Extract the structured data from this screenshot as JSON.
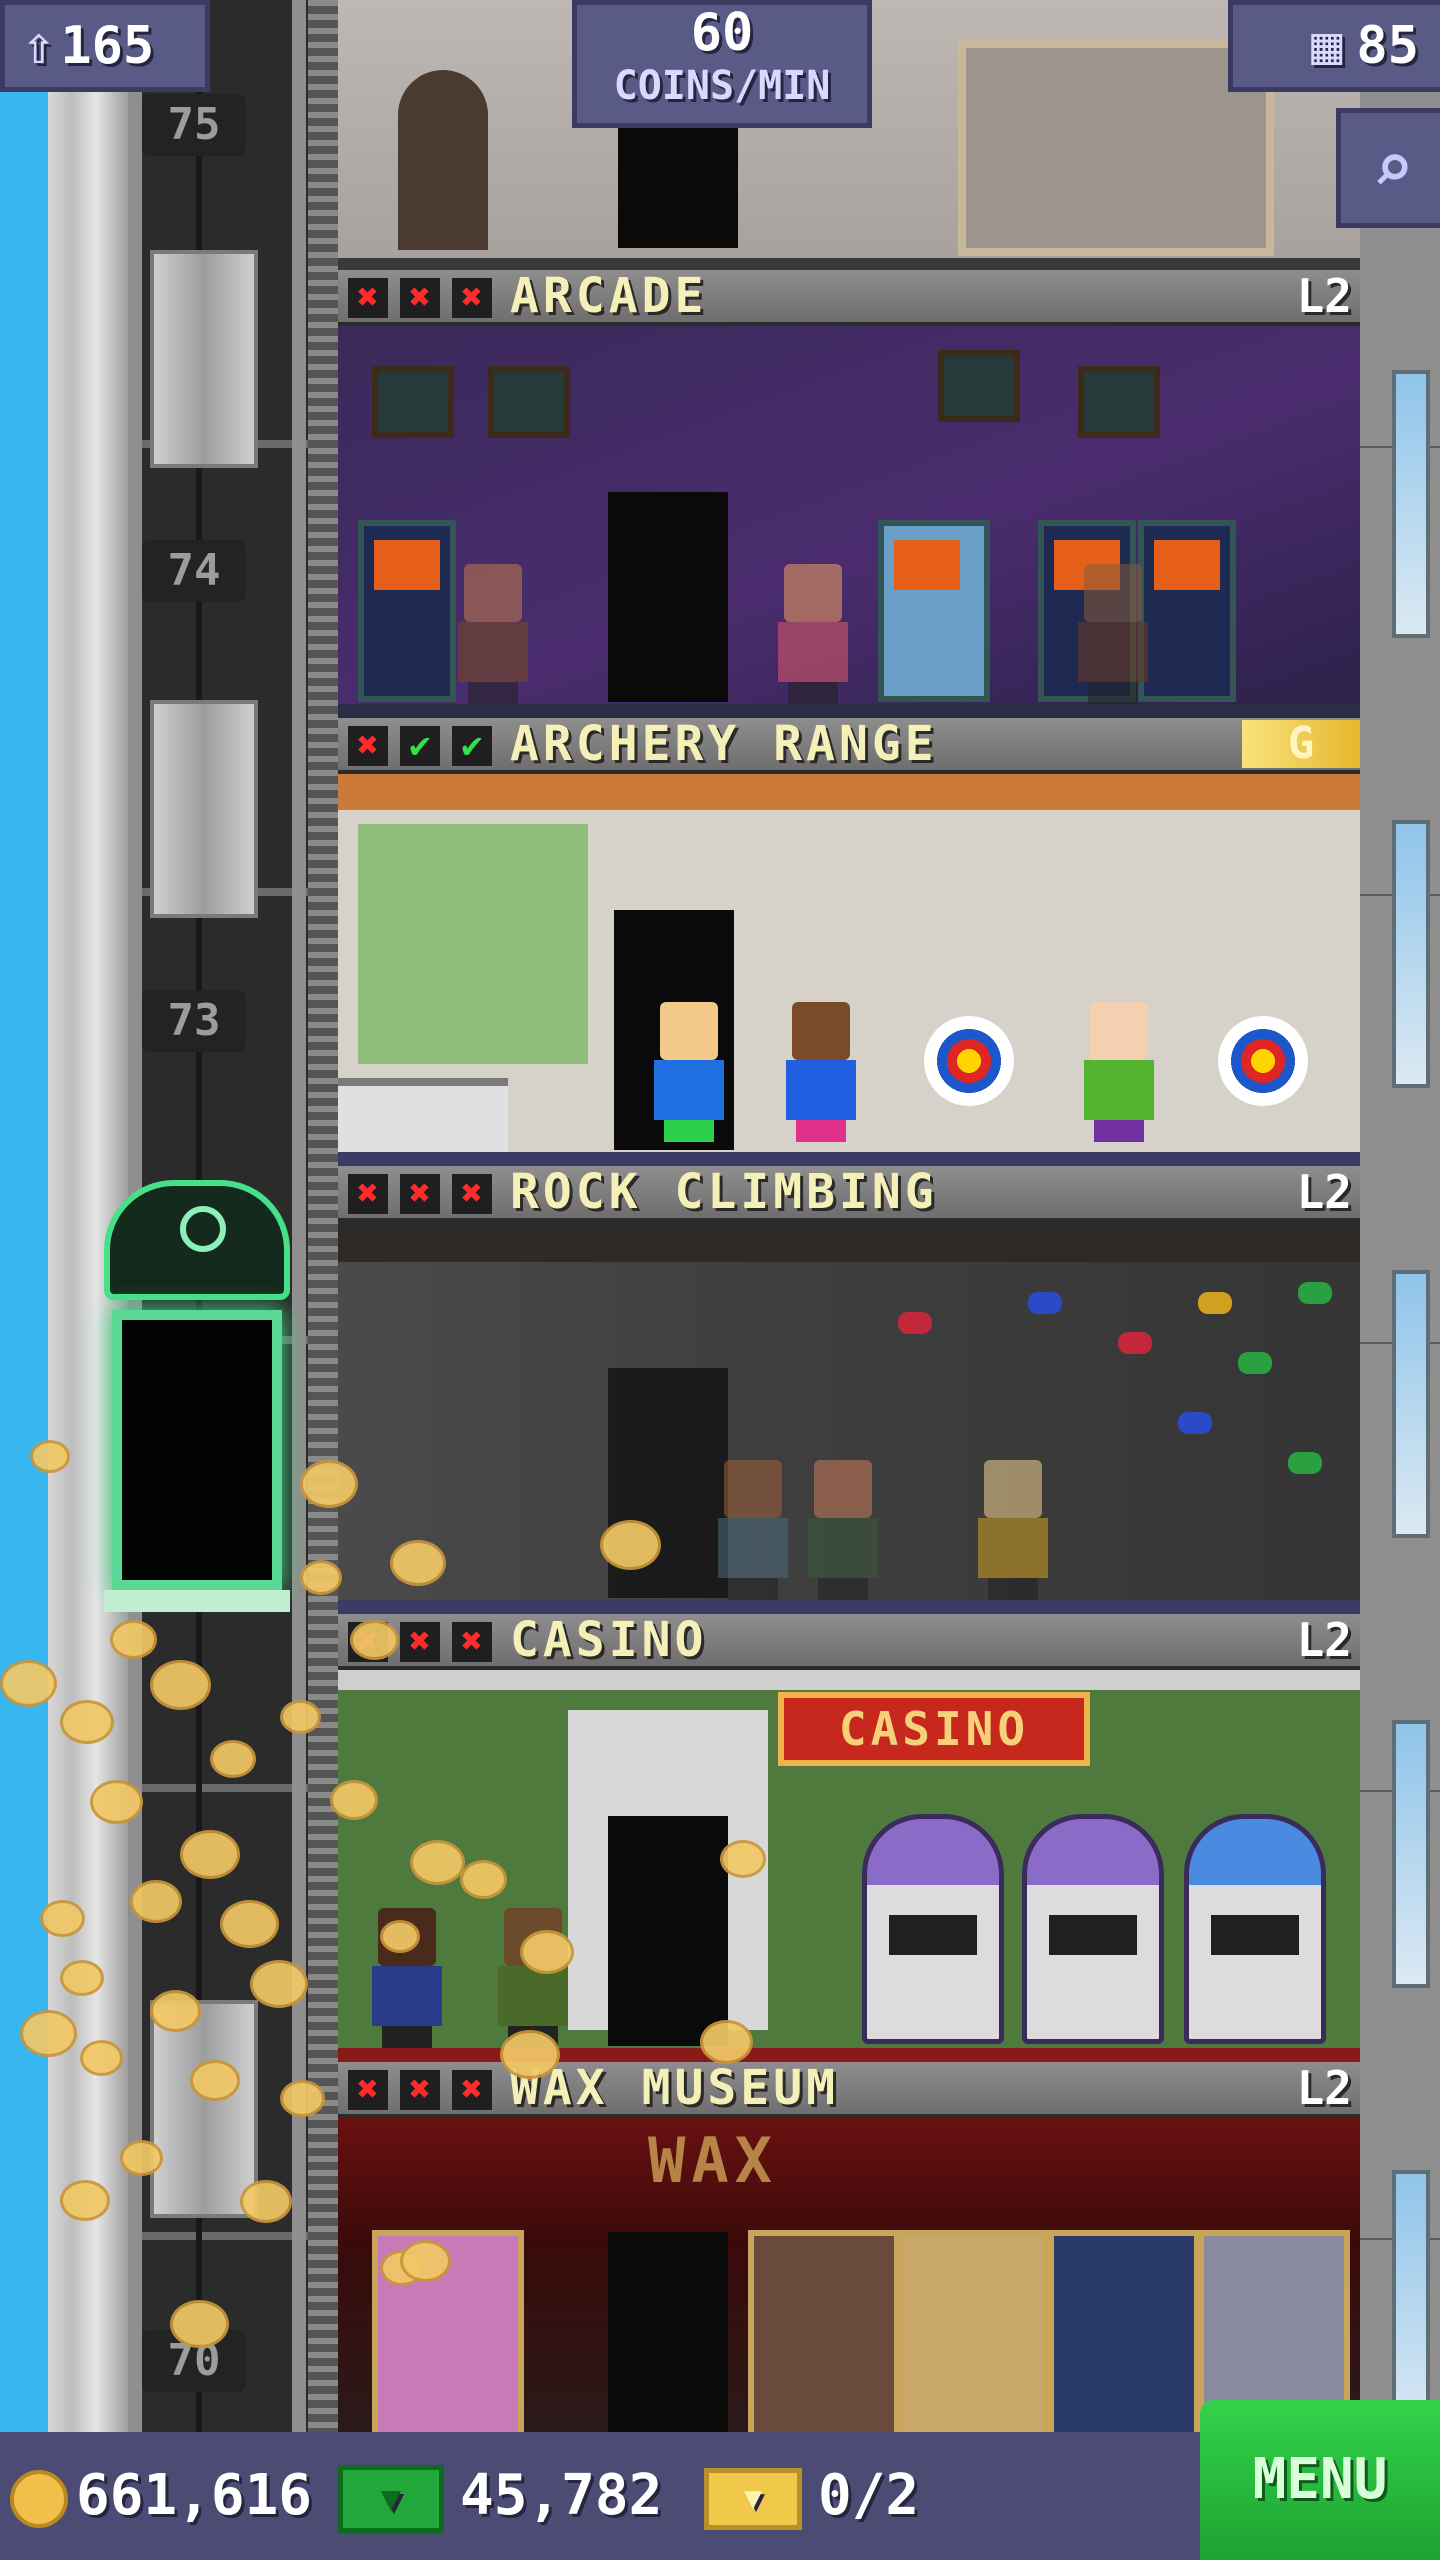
{
  "hud": {
    "population": "165",
    "coins_per_min_value": "60",
    "coins_per_min_unit": "COINS/MIN",
    "floor_count": "85"
  },
  "shaft": {
    "floor_numbers": [
      "75",
      "74",
      "73",
      "70"
    ]
  },
  "floors": [
    {
      "name": "ARCADE",
      "level": "L2",
      "checks": [
        "x",
        "x",
        "x"
      ]
    },
    {
      "name": "ARCHERY RANGE",
      "level": "G",
      "checks": [
        "x",
        "ok",
        "ok"
      ]
    },
    {
      "name": "ROCK CLIMBING",
      "level": "L2",
      "checks": [
        "x",
        "x",
        "x"
      ]
    },
    {
      "name": "CASINO",
      "level": "L2",
      "checks": [
        "x",
        "x",
        "x"
      ]
    },
    {
      "name": "WAX MUSEUM",
      "level": "L2",
      "checks": [
        "x",
        "x",
        "x"
      ]
    }
  ],
  "signs": {
    "casino": "CASINO",
    "wax": "WAX"
  },
  "bottom_bar": {
    "coins": "661,616",
    "bux": "45,782",
    "tickets": "0/2",
    "menu_label": "MENU"
  },
  "icons": {
    "population": "person-up-icon",
    "floors": "building-icon",
    "search": "magnifier-icon",
    "coin": "coin-icon",
    "bux": "bux-icon",
    "ticket": "golden-ticket-icon",
    "check_fail": "red-x-icon",
    "check_ok": "green-check-icon"
  },
  "colors": {
    "sky": "#37b6ef",
    "hud_panel": "#5a5a86",
    "menu_green": "#2bc444",
    "elevator_glow": "#46e08a",
    "floor_title": "#f4f0b8",
    "gold_badge": "#e6b82e"
  }
}
